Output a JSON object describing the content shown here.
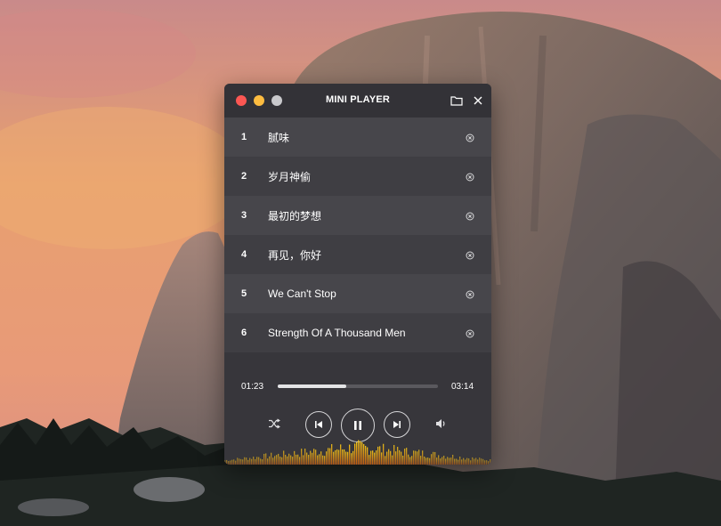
{
  "window": {
    "title": "MINI PLAYER"
  },
  "titlebar_icons": {
    "folder": "folder-icon",
    "close": "close-icon"
  },
  "playlist": [
    {
      "number": "1",
      "title": "腻味"
    },
    {
      "number": "2",
      "title": "岁月神偷"
    },
    {
      "number": "3",
      "title": "最初的梦想"
    },
    {
      "number": "4",
      "title": "再见，你好"
    },
    {
      "number": "5",
      "title": "We Can't Stop"
    },
    {
      "number": "6",
      "title": "Strength Of A Thousand Men"
    }
  ],
  "player": {
    "current_time": "01:23",
    "total_time": "03:14",
    "progress": 0.43,
    "state": "playing"
  },
  "controls": {
    "shuffle": "shuffle-icon",
    "previous": "skip-previous-icon",
    "pause": "pause-icon",
    "next": "skip-next-icon",
    "volume": "volume-icon"
  },
  "colors": {
    "window_bg": "#3b3a3f",
    "accent_visualizer": "#f5c518",
    "traffic_close": "#fc5753",
    "traffic_minimize": "#fdbc40",
    "traffic_maximize": "#c9c9cc"
  }
}
